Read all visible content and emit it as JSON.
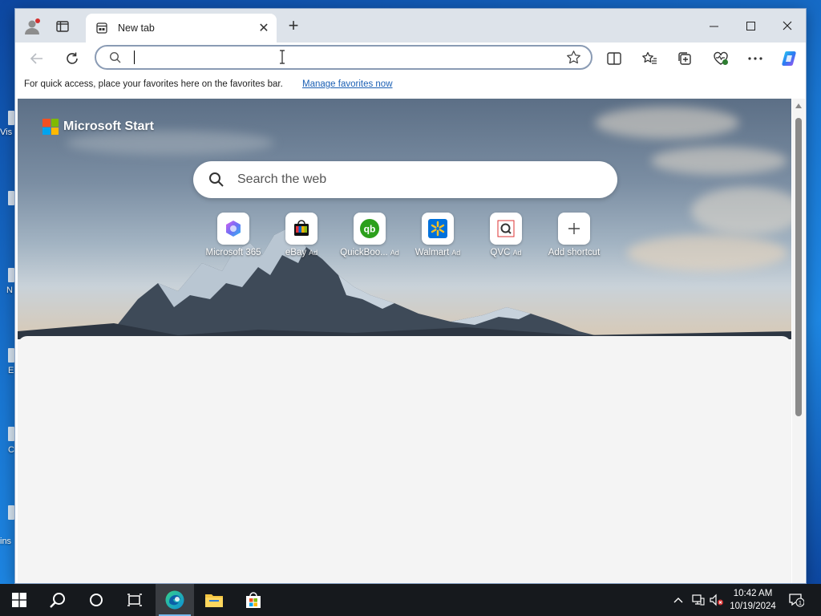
{
  "window": {
    "tab_title": "New tab",
    "controls": {
      "minimize": "—",
      "maximize": "☐",
      "close": "✕"
    }
  },
  "toolbar": {
    "address_value": "",
    "address_placeholder": ""
  },
  "favorites_bar": {
    "message": "For quick access, place your favorites here on the favorites bar.",
    "link_label": "Manage favorites now"
  },
  "page": {
    "brand": "Microsoft Start",
    "search_placeholder": "Search the web",
    "shortcuts": [
      {
        "label": "Microsoft 365",
        "ad": "",
        "icon": "microsoft-365-icon"
      },
      {
        "label": "eBay",
        "ad": "Ad",
        "icon": "ebay-icon"
      },
      {
        "label": "QuickBoo...",
        "ad": "Ad",
        "icon": "quickbooks-icon"
      },
      {
        "label": "Walmart",
        "ad": "Ad",
        "icon": "walmart-icon"
      },
      {
        "label": "QVC",
        "ad": "Ad",
        "icon": "qvc-icon"
      },
      {
        "label": "Add shortcut",
        "ad": "",
        "icon": "plus-icon"
      }
    ]
  },
  "desktop": {
    "partial_labels": [
      "Vis",
      "N",
      "E",
      "C",
      "ins"
    ]
  },
  "taskbar": {
    "time": "10:42 AM",
    "date": "10/19/2024",
    "notification_count": "1"
  },
  "colors": {
    "accent": "#0078d4",
    "link": "#1a5fb4",
    "taskbar": "#16191d"
  }
}
